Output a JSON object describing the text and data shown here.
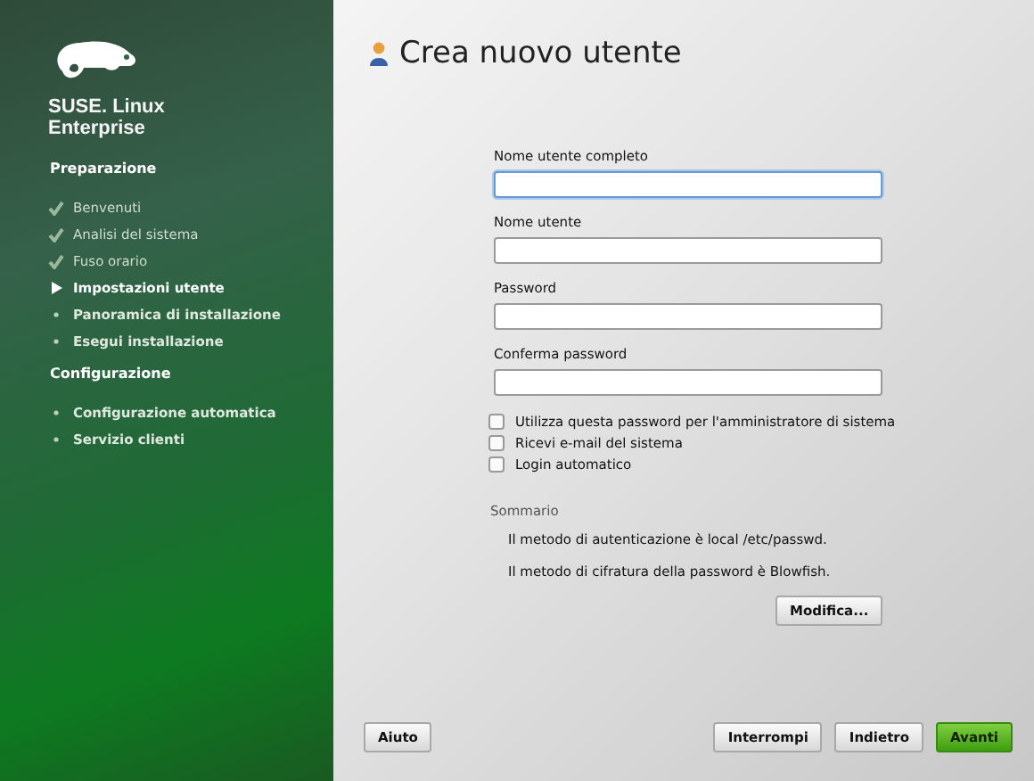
{
  "sidebar": {
    "brand": "SUSE. Linux Enterprise",
    "sections": [
      {
        "title": "Preparazione",
        "items": [
          {
            "label": "Benvenuti",
            "kind": "done"
          },
          {
            "label": "Analisi del sistema",
            "kind": "done"
          },
          {
            "label": "Fuso orario",
            "kind": "done"
          },
          {
            "label": "Impostazioni utente",
            "kind": "current"
          },
          {
            "label": "Panoramica di installazione",
            "kind": "pending"
          },
          {
            "label": "Esegui installazione",
            "kind": "pending"
          }
        ]
      },
      {
        "title": "Configurazione",
        "items": [
          {
            "label": "Configurazione automatica",
            "kind": "pending"
          },
          {
            "label": "Servizio clienti",
            "kind": "pending"
          }
        ]
      }
    ]
  },
  "page": {
    "title": "Crea nuovo utente",
    "fields": [
      {
        "label": "Nome utente completo",
        "focused": true
      },
      {
        "label": "Nome utente",
        "focused": false
      },
      {
        "label": "Password",
        "focused": false
      },
      {
        "label": "Conferma password",
        "focused": false
      }
    ],
    "options": [
      {
        "label": "Utilizza questa password per l'amministratore di sistema",
        "checked": false
      },
      {
        "label": "Ricevi e-mail del sistema",
        "checked": false
      },
      {
        "label": "Login automatico",
        "checked": false
      }
    ],
    "summary": {
      "title": "Sommario",
      "lines": [
        "Il metodo di autenticazione è local /etc/passwd.",
        "Il metodo di cifratura della password è Blowfish."
      ],
      "button": "Modifica..."
    }
  },
  "buttons": [
    {
      "label": "Aiuto",
      "kind": "normal"
    },
    {
      "label": "Interrompi",
      "kind": "normal"
    },
    {
      "label": "Indietro",
      "kind": "normal"
    },
    {
      "label": "Avanti",
      "kind": "primary"
    }
  ]
}
